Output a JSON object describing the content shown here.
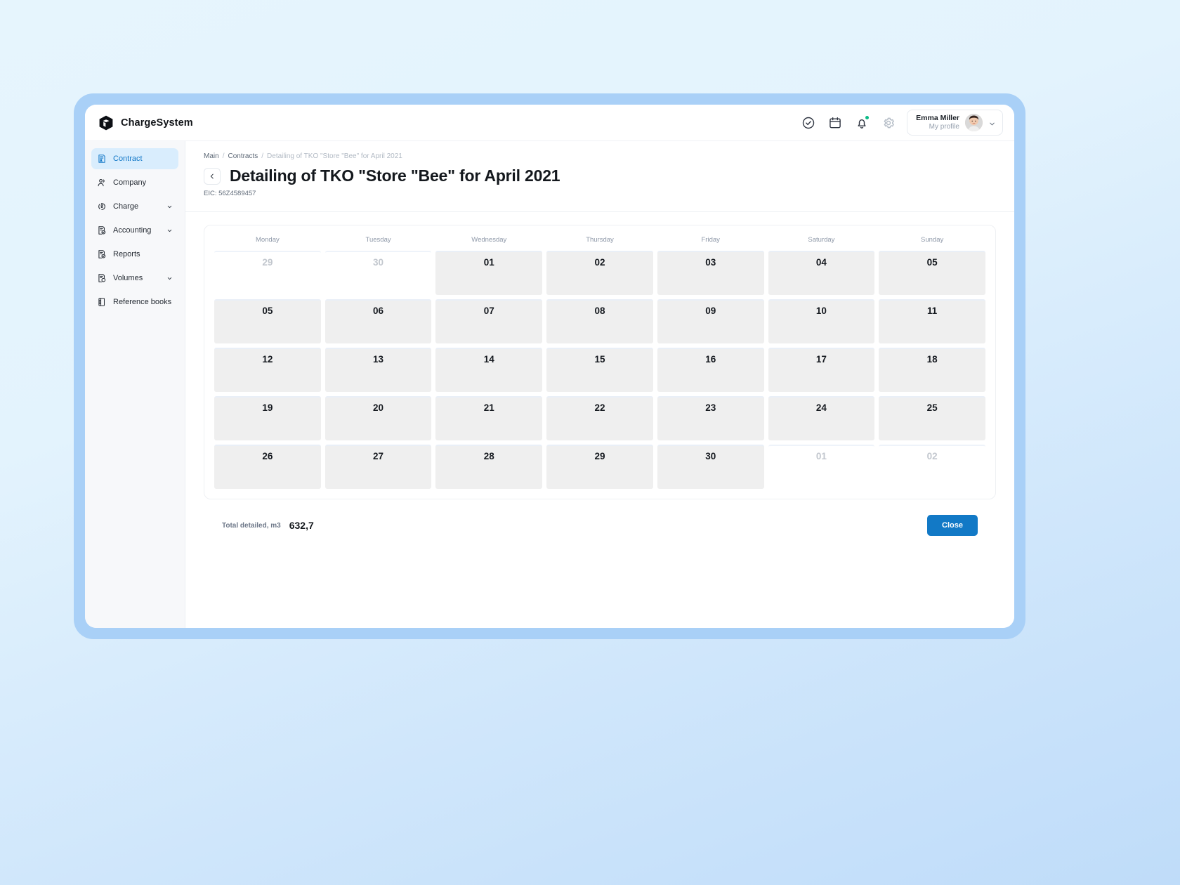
{
  "brand": {
    "name": "ChargeSystem",
    "logo_icon": "cube-icon"
  },
  "topbar": {
    "icons": [
      {
        "name": "check-circle-icon",
        "label": "Tasks"
      },
      {
        "name": "calendar-icon",
        "label": "Calendar"
      },
      {
        "name": "bell-icon",
        "label": "Notifications",
        "has_dot": true
      },
      {
        "name": "gear-icon",
        "label": "Settings"
      }
    ],
    "profile": {
      "name": "Emma Miller",
      "subtitle": "My profile",
      "chevron_icon": "chevron-down-icon"
    }
  },
  "sidebar": {
    "items": [
      {
        "label": "Contract",
        "icon": "contract-icon",
        "active": true,
        "expandable": false
      },
      {
        "label": "Company",
        "icon": "company-icon",
        "active": false,
        "expandable": false
      },
      {
        "label": "Charge",
        "icon": "charge-icon",
        "active": false,
        "expandable": true
      },
      {
        "label": "Accounting",
        "icon": "accounting-icon",
        "active": false,
        "expandable": true
      },
      {
        "label": "Reports",
        "icon": "reports-icon",
        "active": false,
        "expandable": false
      },
      {
        "label": "Volumes",
        "icon": "volumes-icon",
        "active": false,
        "expandable": true
      },
      {
        "label": "Reference books",
        "icon": "reference-books-icon",
        "active": false,
        "expandable": true
      }
    ]
  },
  "page": {
    "breadcrumb": {
      "first": "Main",
      "second": "Contracts",
      "current": "Detailing of TKO \"Store \"Bee\" for April 2021",
      "separator": "/"
    },
    "back_icon": "chevron-left-icon",
    "title": "Detailing of TKO \"Store \"Bee\" for April 2021",
    "eic": "EIC: 56Z4589457"
  },
  "calendar": {
    "weekdays": [
      "Monday",
      "Tuesday",
      "Wednesday",
      "Thursday",
      "Friday",
      "Saturday",
      "Sunday"
    ],
    "days": [
      {
        "label": "29",
        "in_month": false
      },
      {
        "label": "30",
        "in_month": false
      },
      {
        "label": "01",
        "in_month": true
      },
      {
        "label": "02",
        "in_month": true
      },
      {
        "label": "03",
        "in_month": true
      },
      {
        "label": "04",
        "in_month": true
      },
      {
        "label": "05",
        "in_month": true
      },
      {
        "label": "05",
        "in_month": true
      },
      {
        "label": "06",
        "in_month": true
      },
      {
        "label": "07",
        "in_month": true
      },
      {
        "label": "08",
        "in_month": true
      },
      {
        "label": "09",
        "in_month": true
      },
      {
        "label": "10",
        "in_month": true
      },
      {
        "label": "11",
        "in_month": true
      },
      {
        "label": "12",
        "in_month": true
      },
      {
        "label": "13",
        "in_month": true
      },
      {
        "label": "14",
        "in_month": true
      },
      {
        "label": "15",
        "in_month": true
      },
      {
        "label": "16",
        "in_month": true
      },
      {
        "label": "17",
        "in_month": true
      },
      {
        "label": "18",
        "in_month": true
      },
      {
        "label": "19",
        "in_month": true
      },
      {
        "label": "20",
        "in_month": true
      },
      {
        "label": "21",
        "in_month": true
      },
      {
        "label": "22",
        "in_month": true
      },
      {
        "label": "23",
        "in_month": true
      },
      {
        "label": "24",
        "in_month": true
      },
      {
        "label": "25",
        "in_month": true
      },
      {
        "label": "26",
        "in_month": true
      },
      {
        "label": "27",
        "in_month": true
      },
      {
        "label": "28",
        "in_month": true
      },
      {
        "label": "29",
        "in_month": true
      },
      {
        "label": "30",
        "in_month": true
      },
      {
        "label": "01",
        "in_month": false
      },
      {
        "label": "02",
        "in_month": false
      }
    ]
  },
  "footer": {
    "total_label": "Total detailed, m3",
    "total_value": "632,7",
    "close_label": "Close"
  },
  "colors": {
    "accent": "#1279c6",
    "sidebar_active_bg": "#d9edfd",
    "sidebar_active_text": "#1579c8",
    "notification_dot": "#0bbb87",
    "day_cell": "#efefef"
  }
}
